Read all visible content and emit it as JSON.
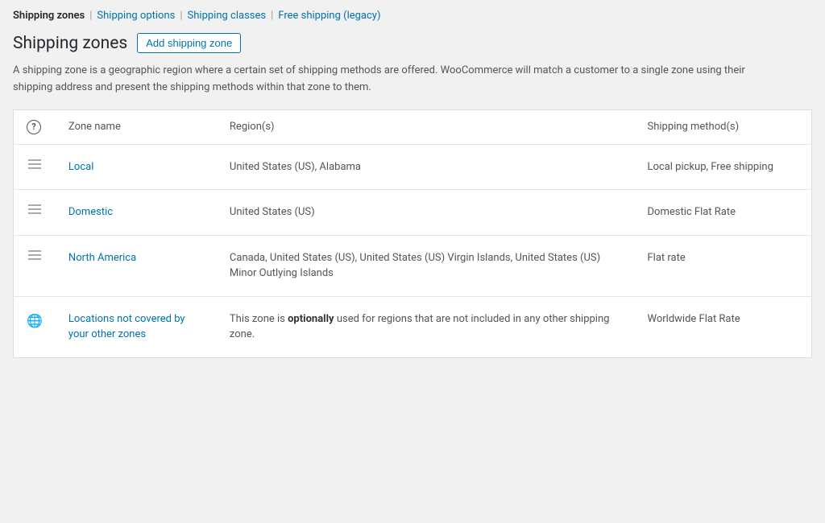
{
  "nav": {
    "tabs": [
      {
        "id": "shipping-zones",
        "label": "Shipping zones",
        "active": true
      },
      {
        "id": "shipping-options",
        "label": "Shipping options",
        "active": false
      },
      {
        "id": "shipping-classes",
        "label": "Shipping classes",
        "active": false
      },
      {
        "id": "free-shipping",
        "label": "Free shipping (legacy)",
        "active": false
      }
    ]
  },
  "page": {
    "title": "Shipping zones",
    "add_button": "Add shipping zone",
    "description": "A shipping zone is a geographic region where a certain set of shipping methods are offered. WooCommerce will match a customer to a single zone using their shipping address and present the shipping methods within that zone to them."
  },
  "table": {
    "headers": {
      "question": "?",
      "zone_name": "Zone name",
      "regions": "Region(s)",
      "shipping_methods": "Shipping method(s)"
    },
    "rows": [
      {
        "id": "local",
        "zone_name": "Local",
        "regions": "United States (US), Alabama",
        "shipping_methods": "Local pickup, Free shipping",
        "drag": true
      },
      {
        "id": "domestic",
        "zone_name": "Domestic",
        "regions": "United States (US)",
        "shipping_methods": "Domestic Flat Rate",
        "drag": true
      },
      {
        "id": "north-america",
        "zone_name": "North America",
        "regions": "Canada, United States (US), United States (US) Virgin Islands, United States (US) Minor Outlying Islands",
        "shipping_methods": "Flat rate",
        "drag": true
      }
    ],
    "special_row": {
      "zone_name_line1": "Locations not covered by",
      "zone_name_line2": "your other zones",
      "region_pre": "This zone is ",
      "region_bold": "optionally",
      "region_post": " used for regions that are not included in any other shipping zone.",
      "shipping_methods": "Worldwide Flat Rate"
    }
  }
}
